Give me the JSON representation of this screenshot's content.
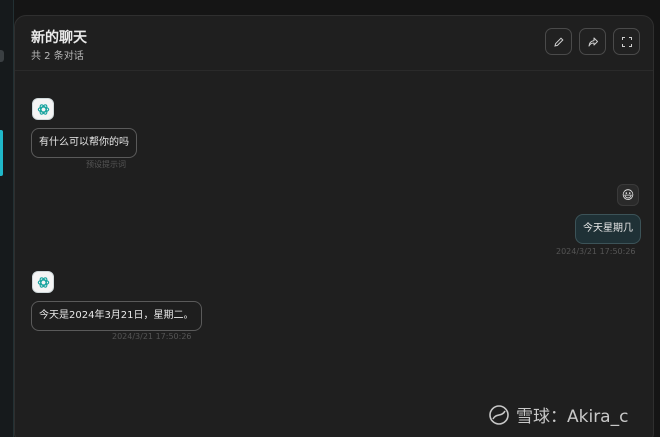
{
  "header": {
    "title": "新的聊天",
    "subtitle": "共 2 条对话"
  },
  "messages": [
    {
      "role": "assistant",
      "text": "有什么可以帮你的吗",
      "meta": "预设提示词"
    },
    {
      "role": "user",
      "text": "今天星期几",
      "meta": "2024/3/21 17:50:26",
      "avatar": "😃"
    },
    {
      "role": "assistant",
      "text": "今天是2024年3月21日，星期二。",
      "meta": "2024/3/21 17:50:26"
    }
  ],
  "icons": {
    "edit": "pencil-icon",
    "share": "share-icon",
    "fullscreen": "fullscreen-icon",
    "assistant_avatar": "openai-icon"
  },
  "watermark": {
    "text": "雪球：Akira_c"
  },
  "colors": {
    "accent": "#1fb8c9",
    "background": "#1f1f1f",
    "user_bubble": "#1f3136"
  }
}
